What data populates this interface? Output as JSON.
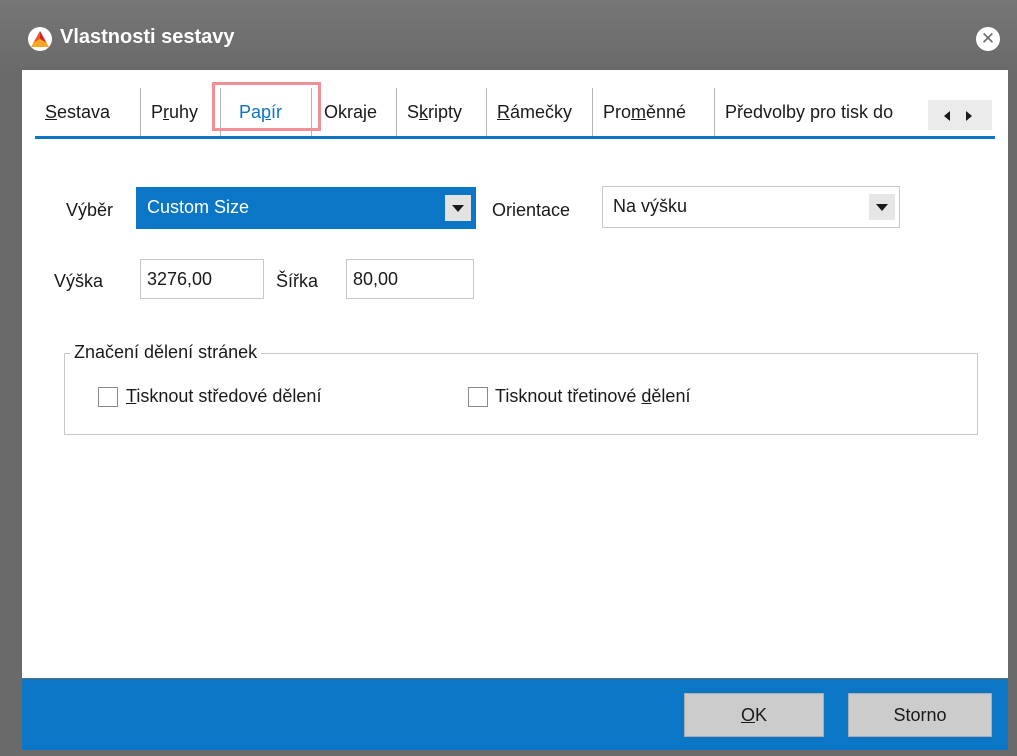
{
  "window": {
    "title": "Vlastnosti sestavy"
  },
  "tabs": [
    {
      "label": "Sestava",
      "u": "S",
      "rest": "estava"
    },
    {
      "label": "Pruhy",
      "pre": "P",
      "u": "r",
      "rest": "uhy"
    },
    {
      "label": "Papír",
      "pre": "Pa",
      "u": "p",
      "rest": "ír"
    },
    {
      "label": "Okraje",
      "pre": "Okra",
      "u": "j",
      "rest": "e"
    },
    {
      "label": "Skripty",
      "pre": "S",
      "u": "k",
      "rest": "ripty"
    },
    {
      "label": "Rámečky",
      "pre": "",
      "u": "R",
      "rest": "ámečky"
    },
    {
      "label": "Proměnné",
      "pre": "Pro",
      "u": "m",
      "rest": "ěnné"
    },
    {
      "label": "Předvolby pro tisk do"
    }
  ],
  "active_tab": "Papír",
  "form": {
    "vyber_label": "Výběr",
    "vyber_value": "Custom Size",
    "orientace_label": "Orientace",
    "orientace_value": "Na výšku",
    "vyska_label": "Výška",
    "vyska_value": "3276,00",
    "sirka_label": "Šířka",
    "sirka_value": "80,00"
  },
  "page_division": {
    "title": "Značení dělení stránek",
    "center_label_u": "T",
    "center_label_rest": "isknout středové dělení",
    "center_checked": false,
    "third_label_pre": "Tisknout třetinové ",
    "third_label_u": "d",
    "third_label_rest": "ělení",
    "third_checked": false
  },
  "buttons": {
    "ok_u": "O",
    "ok_rest": "K",
    "cancel": "Storno"
  },
  "colors": {
    "accent": "#0a76c5",
    "titlebar": "#6a6a6a",
    "highlight": "#f29097"
  }
}
